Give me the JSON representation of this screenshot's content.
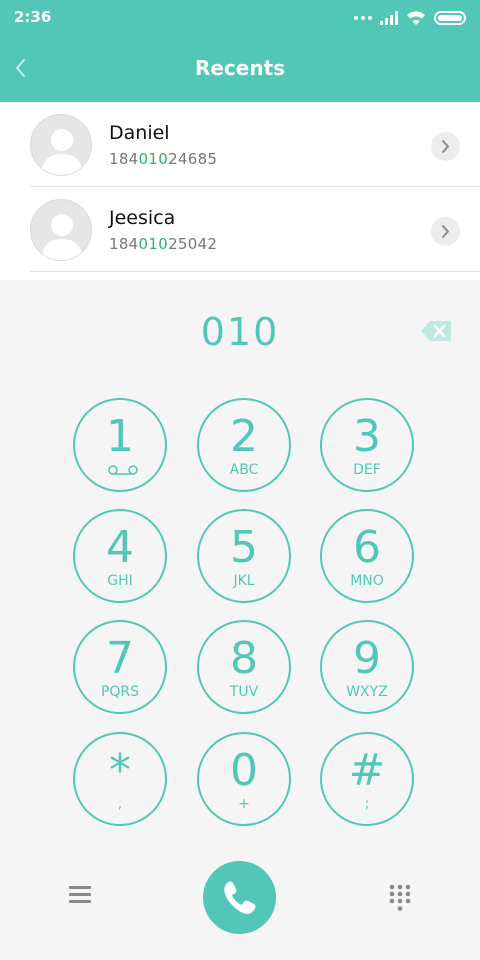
{
  "status_bar": {
    "time": "2:36",
    "icons": [
      "more-dots-icon",
      "signal-icon",
      "wifi-icon",
      "battery-icon"
    ]
  },
  "header": {
    "title": "Recents",
    "back_icon": "chevron-left-icon"
  },
  "recents": [
    {
      "name": "Daniel",
      "number_prefix": "184",
      "number_match": "010",
      "number_suffix": "24685"
    },
    {
      "name": "Jeesica",
      "number_prefix": "184",
      "number_match": "010",
      "number_suffix": "25042"
    }
  ],
  "dialer": {
    "dialed_number": "010",
    "keys": [
      {
        "digit": "1",
        "letters": ""
      },
      {
        "digit": "2",
        "letters": "ABC"
      },
      {
        "digit": "3",
        "letters": "DEF"
      },
      {
        "digit": "4",
        "letters": "GHI"
      },
      {
        "digit": "5",
        "letters": "JKL"
      },
      {
        "digit": "6",
        "letters": "MNO"
      },
      {
        "digit": "7",
        "letters": "PQRS"
      },
      {
        "digit": "8",
        "letters": "TUV"
      },
      {
        "digit": "9",
        "letters": "WXYZ"
      },
      {
        "digit": "*",
        "letters": ","
      },
      {
        "digit": "0",
        "letters": "+"
      },
      {
        "digit": "#",
        "letters": ";"
      }
    ]
  },
  "colors": {
    "accent": "#52c7b8",
    "match_highlight": "#2eb36a",
    "background": "#f5f5f5"
  }
}
